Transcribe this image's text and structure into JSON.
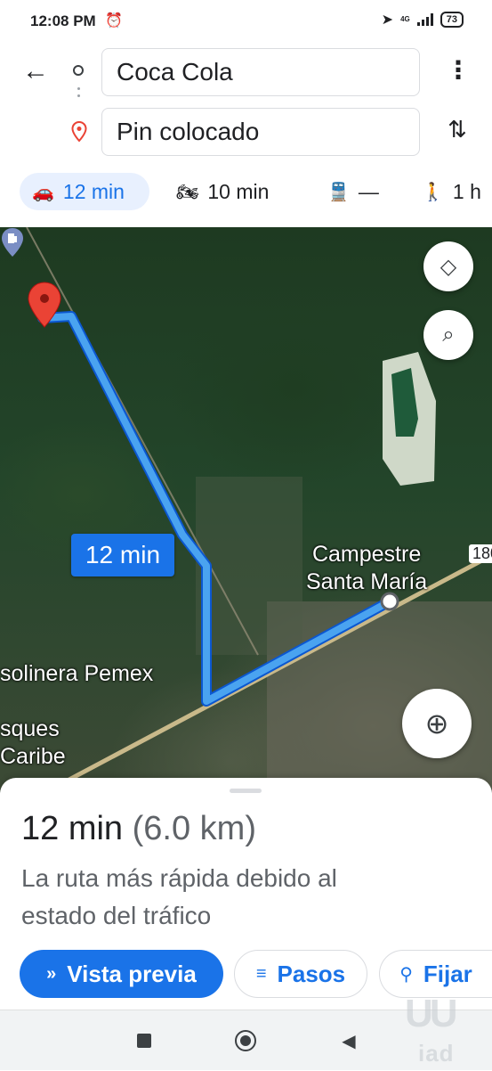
{
  "status_bar": {
    "time": "12:08 PM",
    "alarm_icon": "alarm-icon",
    "network": "4G",
    "battery": "73"
  },
  "header": {
    "origin": "Coca Cola",
    "destination": "Pin colocado"
  },
  "modes": {
    "car": {
      "icon": "car-icon",
      "label": "12 min",
      "selected": true
    },
    "motorcycle": {
      "icon": "motorcycle-icon",
      "label": "10 min"
    },
    "transit": {
      "icon": "train-icon",
      "label": "—"
    },
    "walk": {
      "icon": "walking-icon",
      "label": "1 h"
    }
  },
  "map": {
    "route_badge": "12 min",
    "labels": {
      "campestre": "Campestre",
      "santa_maria": "Santa María",
      "pemex": "solinera Pemex",
      "bosques": "sques",
      "caribe": "Caribe",
      "highway": "180"
    },
    "route_color": "#1a73e8"
  },
  "sheet": {
    "duration": "12 min",
    "distance": "(6.0 km)",
    "description": "La ruta más rápida debido al estado del tráfico",
    "buttons": {
      "preview": "Vista previa",
      "steps": "Pasos",
      "pin": "Fijar"
    }
  },
  "watermark": {
    "mark": "UU",
    "text": "iad"
  }
}
